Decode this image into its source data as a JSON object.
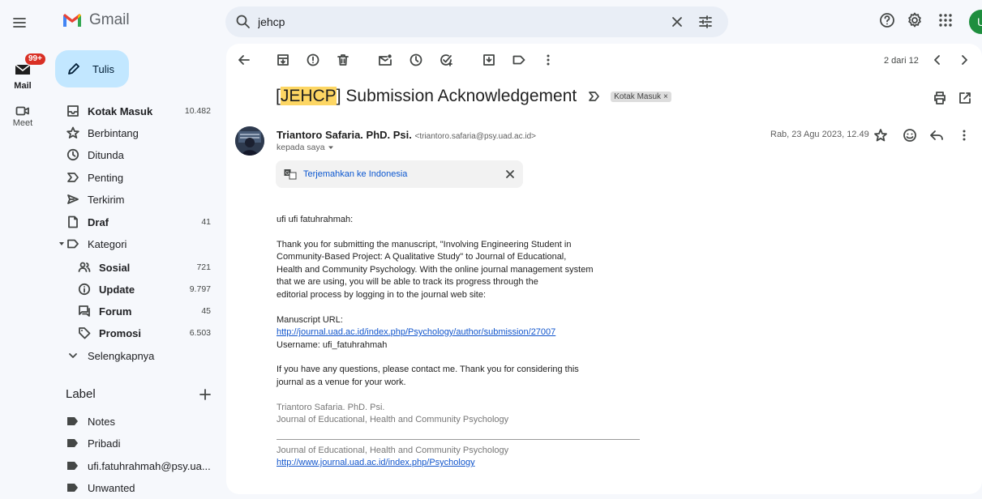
{
  "app": {
    "logo_text": "Gmail"
  },
  "search": {
    "value": "jehcp"
  },
  "account": {
    "avatar_letter": "U"
  },
  "rail": {
    "mail_label": "Mail",
    "mail_badge": "99+",
    "meet_label": "Meet"
  },
  "compose": {
    "label": "Tulis"
  },
  "nav": [
    {
      "label": "Kotak Masuk",
      "count": "10.482",
      "bold": true
    },
    {
      "label": "Berbintang",
      "count": ""
    },
    {
      "label": "Ditunda",
      "count": ""
    },
    {
      "label": "Penting",
      "count": ""
    },
    {
      "label": "Terkirim",
      "count": ""
    },
    {
      "label": "Draf",
      "count": "41",
      "bold": true
    },
    {
      "label": "Kategori",
      "count": ""
    },
    {
      "label": "Sosial",
      "count": "721",
      "bold": true
    },
    {
      "label": "Update",
      "count": "9.797",
      "bold": true
    },
    {
      "label": "Forum",
      "count": "45",
      "bold": true
    },
    {
      "label": "Promosi",
      "count": "6.503",
      "bold": true
    },
    {
      "label": "Selengkapnya",
      "count": ""
    }
  ],
  "labels": {
    "header": "Label",
    "items": [
      "Notes",
      "Pribadi",
      "ufi.fatuhrahmah@psy.ua...",
      "Unwanted"
    ]
  },
  "pager": {
    "text": "2 dari 12"
  },
  "message": {
    "subject_tag": "JEHCP",
    "subject_bracket_open": "[",
    "subject_bracket_close": "]",
    "subject_rest": " Submission Acknowledgement",
    "chip": "Kotak Masuk",
    "chip_close": "×",
    "sender_name": "Triantoro Safaria. PhD. Psi.",
    "sender_email": "<triantoro.safaria@psy.uad.ac.id>",
    "to": "kepada saya",
    "date": "Rab, 23 Agu 2023, 12.49",
    "translate": "Terjemahkan ke Indonesia",
    "greeting": "ufi ufi fatuhrahmah:",
    "para1": [
      "Thank you for submitting the manuscript, \"Involving Engineering Student in",
      "Community-Based Project: A Qualitative Study\" to Journal of Educational,",
      "Health and Community Psychology. With the online journal management system",
      "that we are using, you will be able to track its progress through the",
      "editorial process by logging in to the journal web site:"
    ],
    "url_label": "Manuscript URL:",
    "url": "http://journal.uad.ac.id/index.php/Psychology/author/submission/27007",
    "username": "Username: ufi_fatuhrahmah",
    "para2": [
      "If you have any questions, please contact me. Thank you for considering this",
      "journal as a venue for your work."
    ],
    "sig1": "Triantoro Safaria. PhD. Psi.",
    "sig2": "Journal of Educational, Health and Community Psychology",
    "footer1": "Journal of Educational, Health and Community Psychology",
    "footer_url": "http://www.journal.uad.ac.id/index.php/Psychology"
  },
  "colors": {
    "compose_bg": "#c2e7ff",
    "badge": "#d93025",
    "highlight": "#fdd663",
    "link": "#1155cc"
  }
}
